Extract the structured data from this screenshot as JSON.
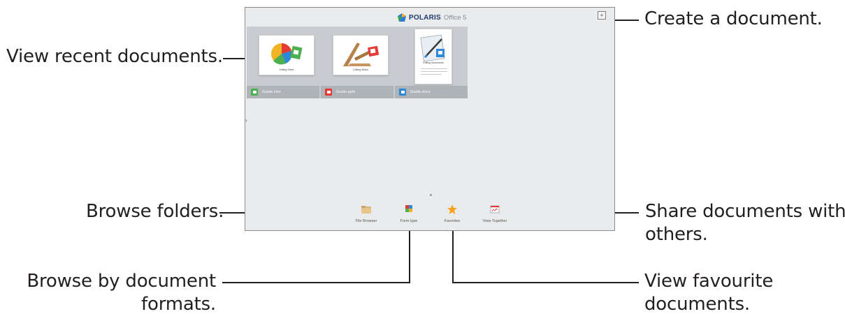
{
  "app": {
    "brand_name": "POLARIS",
    "brand_version": "Office 5"
  },
  "toolbar": {
    "create_icon": "plus-square-icon"
  },
  "recent_documents": [
    {
      "name": "Guide.xlsx",
      "type": "xlsx",
      "thumbnail_caption": "Editing Sheet"
    },
    {
      "name": "Guide.pptx",
      "type": "pptx",
      "thumbnail_caption": "Editing Slides"
    },
    {
      "name": "Guide.docx",
      "type": "docx",
      "thumbnail_caption": "Editing Documents"
    }
  ],
  "bottom_bar": [
    {
      "label": "File Browser",
      "icon": "folder-icon"
    },
    {
      "label": "Form type",
      "icon": "form-type-icon"
    },
    {
      "label": "Favorites",
      "icon": "star-icon"
    },
    {
      "label": "View Together",
      "icon": "view-together-icon"
    }
  ],
  "callouts": {
    "view_recent": "View recent documents.",
    "create_document": "Create a document.",
    "browse_folders": "Browse folders.",
    "share_line1": "Share documents with",
    "share_line2": "others.",
    "formats_line1": "Browse by document",
    "formats_line2": "formats.",
    "favourite_line1": "View favourite",
    "favourite_line2": "documents."
  },
  "colors": {
    "screen_background": "#eaebec",
    "recent_strip": "#c8ccd0",
    "xlsx": "#4caf50",
    "pptx": "#e53935",
    "docx": "#2e88d8",
    "favorites_star": "#f7a21b"
  }
}
